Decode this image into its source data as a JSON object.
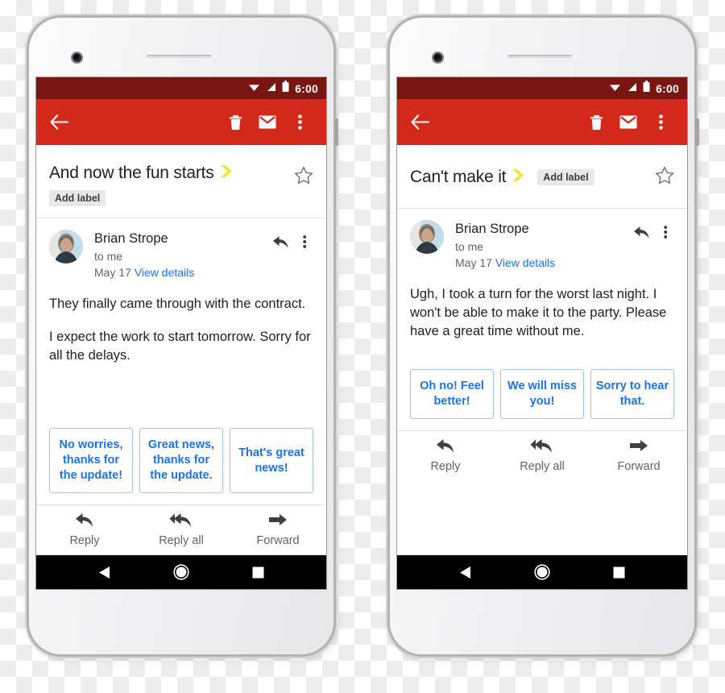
{
  "phones": [
    {
      "id": "left",
      "statusbar": {
        "time": "6:00",
        "icons": [
          "wifi-icon",
          "signal-icon",
          "battery-icon"
        ]
      },
      "appbar": {
        "back_label": "back-arrow-icon",
        "actions": [
          "delete-icon",
          "mark-unread-icon",
          "overflow-menu-icon"
        ]
      },
      "subject": {
        "text": "And now the fun starts",
        "important_marker": "important-chevron-icon",
        "add_label": "Add label",
        "layout": "stacked",
        "starred": false
      },
      "message": {
        "sender": "Brian Strope",
        "recipient": "to me",
        "date": "May 17",
        "details_link": "View details",
        "reply_icon": "reply-arrow-icon",
        "overflow_icon": "overflow-menu-icon",
        "paragraphs": [
          "They finally came through with the contract.",
          "I expect the work to start tomorrow. Sorry for all the delays."
        ]
      },
      "smart_replies": [
        "No worries, thanks for the update!",
        "Great news, thanks for the update.",
        "That's great news!"
      ],
      "actions": [
        {
          "label": "Reply",
          "icon": "reply-icon"
        },
        {
          "label": "Reply all",
          "icon": "reply-all-icon"
        },
        {
          "label": "Forward",
          "icon": "forward-icon"
        }
      ],
      "navbar": [
        "back-triangle-icon",
        "home-circle-icon",
        "recents-square-icon"
      ]
    },
    {
      "id": "right",
      "statusbar": {
        "time": "6:00",
        "icons": [
          "wifi-icon",
          "signal-icon",
          "battery-icon"
        ]
      },
      "appbar": {
        "back_label": "back-arrow-icon",
        "actions": [
          "delete-icon",
          "mark-unread-icon",
          "overflow-menu-icon"
        ]
      },
      "subject": {
        "text": "Can't make it",
        "important_marker": "important-chevron-icon",
        "add_label": "Add label",
        "layout": "inline",
        "starred": false
      },
      "message": {
        "sender": "Brian Strope",
        "recipient": "to me",
        "date": "May 17",
        "details_link": "View details",
        "reply_icon": "reply-arrow-icon",
        "overflow_icon": "overflow-menu-icon",
        "paragraphs": [
          "Ugh, I took a turn for the worst last night. I won't be able to make it to the party. Please have a great time without me."
        ]
      },
      "smart_replies": [
        "Oh no! Feel better!",
        "We will miss you!",
        "Sorry to hear that."
      ],
      "actions": [
        {
          "label": "Reply",
          "icon": "reply-icon"
        },
        {
          "label": "Reply all",
          "icon": "reply-all-icon"
        },
        {
          "label": "Forward",
          "icon": "forward-icon"
        }
      ],
      "navbar": [
        "back-triangle-icon",
        "home-circle-icon",
        "recents-square-icon"
      ]
    }
  ],
  "colors": {
    "statusbar": "#7a1511",
    "appbar": "#d5281c",
    "link": "#1a73e8",
    "chip_border": "#9ec1f5",
    "important_marker": "#f7e02e",
    "navbar": "#000000"
  }
}
